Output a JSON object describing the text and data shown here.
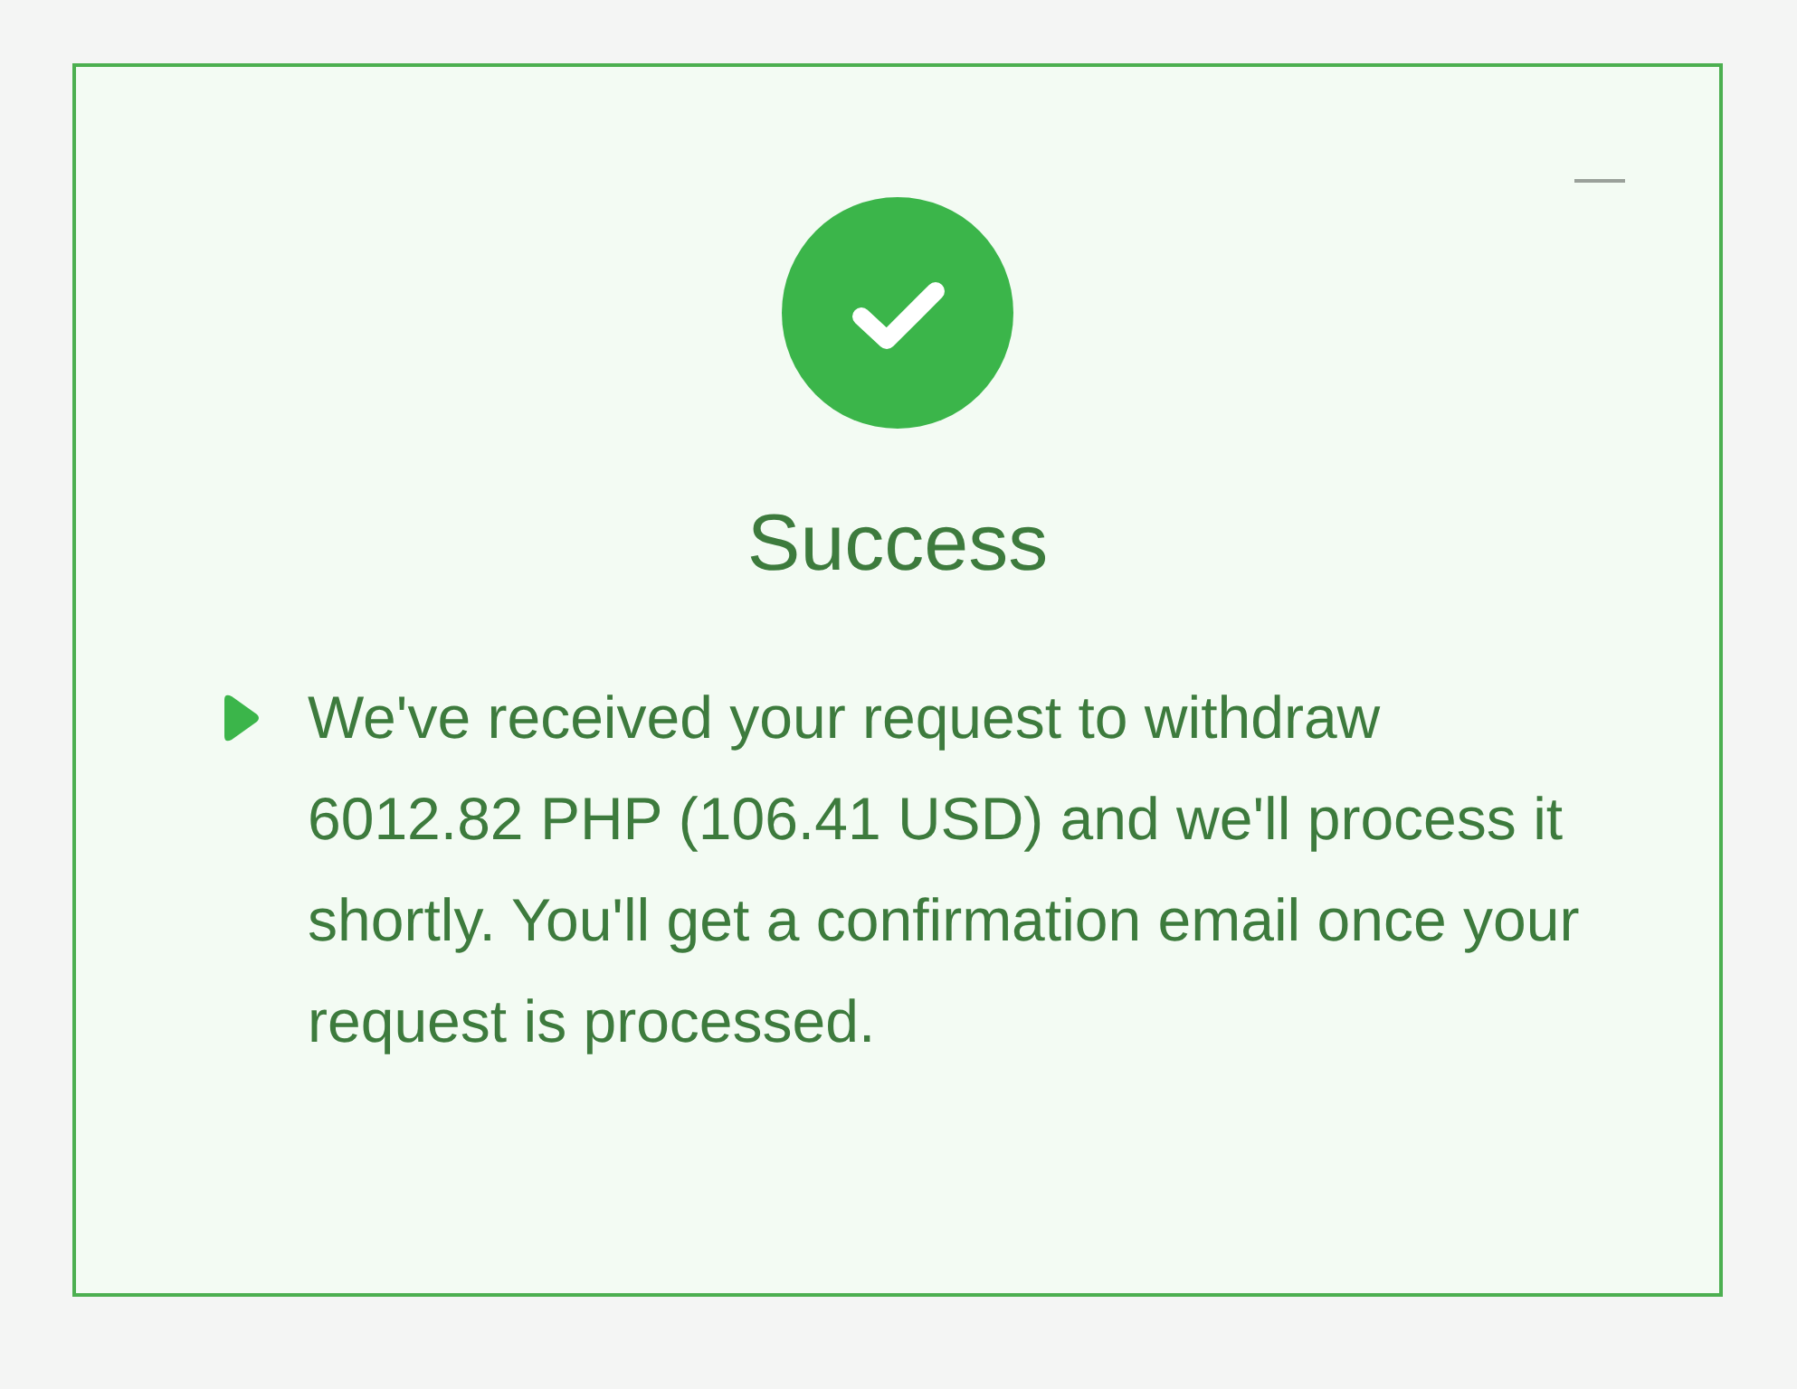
{
  "dialog": {
    "title": "Success",
    "message": "We've received your request to withdraw 6012.82 PHP (106.41 USD) and we'll process it shortly. You'll get a confirmation email once your request is processed."
  }
}
